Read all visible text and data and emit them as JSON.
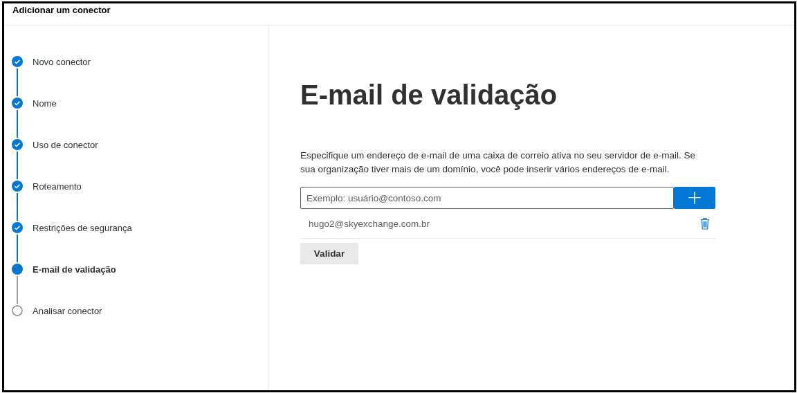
{
  "window": {
    "title": "Adicionar um conector"
  },
  "steps": [
    {
      "label": "Novo conector",
      "kind": "done"
    },
    {
      "label": "Nome",
      "kind": "done"
    },
    {
      "label": "Uso de conector",
      "kind": "done"
    },
    {
      "label": "Roteamento",
      "kind": "done"
    },
    {
      "label": "Restrições de segurança",
      "kind": "done"
    },
    {
      "label": "E-mail de validação",
      "kind": "current"
    },
    {
      "label": "Analisar conector",
      "kind": "pending"
    }
  ],
  "content": {
    "heading": "E-mail de validação",
    "description": "Especifique um endereço de e-mail de uma caixa de correio ativa no seu servidor de e-mail. Se sua organização tiver mais de um domínio, você pode inserir vários endereços de e-mail.",
    "email_field": {
      "placeholder": "Exemplo: usuário@contoso.com"
    },
    "add_button": "+",
    "emails": [
      "hugo2@skyexchange.com.br"
    ],
    "validate_button": "Validar"
  }
}
